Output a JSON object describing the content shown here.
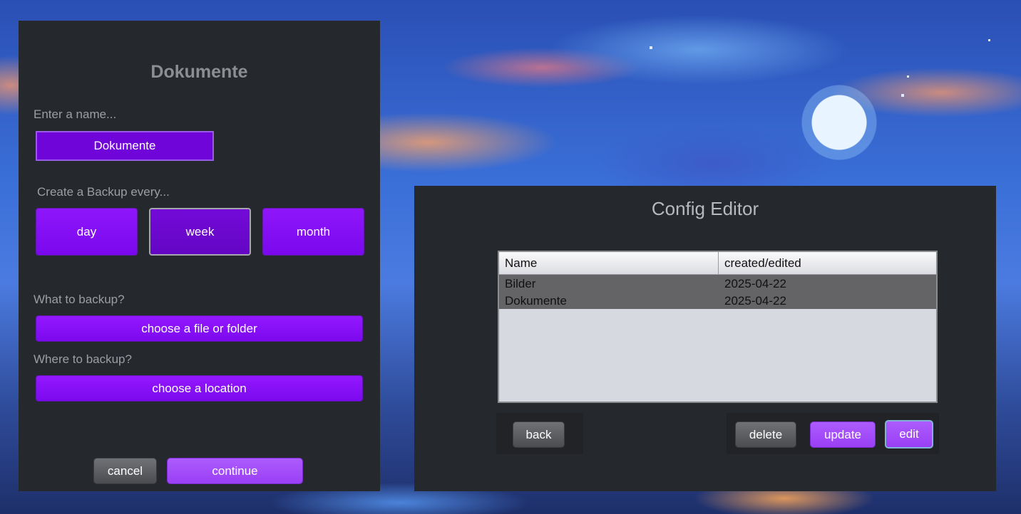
{
  "backup_dialog": {
    "title": "Dokumente",
    "name_label": "Enter a name...",
    "name_value": "Dokumente",
    "frequency_label": "Create a Backup every...",
    "frequency_options": [
      "day",
      "week",
      "month"
    ],
    "frequency_selected": "week",
    "source_label": "What to backup?",
    "source_button": "choose a file or folder",
    "target_label": "Where to backup?",
    "target_button": "choose a location",
    "cancel_label": "cancel",
    "continue_label": "continue"
  },
  "config_editor": {
    "title": "Config Editor",
    "columns": [
      "Name",
      "created/edited"
    ],
    "rows": [
      {
        "name": "Bilder",
        "date": "2025-04-22"
      },
      {
        "name": "Dokumente",
        "date": "2025-04-22"
      }
    ],
    "back_label": "back",
    "delete_label": "delete",
    "update_label": "update",
    "edit_label": "edit"
  },
  "colors": {
    "panel_bg": "#25282d",
    "accent_purple": "#8f16fa",
    "selected_purple": "#6f05d8",
    "table_bg": "#d6d9e0",
    "row_selected": "#646466"
  }
}
